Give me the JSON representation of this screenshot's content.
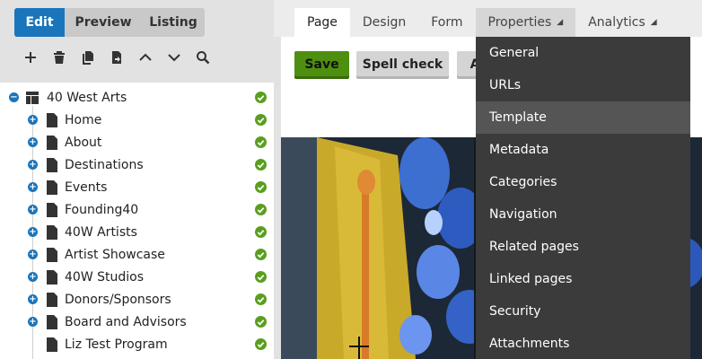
{
  "mode_tabs": {
    "edit": "Edit",
    "preview": "Preview",
    "listing": "Listing"
  },
  "toolbar_icons": [
    "plus-icon",
    "trash-icon",
    "copy-icon",
    "move-icon",
    "chevron-up-icon",
    "chevron-down-icon",
    "search-icon"
  ],
  "tree": {
    "root": {
      "label": "40 West Arts",
      "expanded": true,
      "published": true
    },
    "children": [
      {
        "label": "Home",
        "has_children": true,
        "published": true
      },
      {
        "label": "About",
        "has_children": true,
        "published": true
      },
      {
        "label": "Destinations",
        "has_children": true,
        "published": true
      },
      {
        "label": "Events",
        "has_children": true,
        "published": true
      },
      {
        "label": "Founding40",
        "has_children": true,
        "published": true
      },
      {
        "label": "40W Artists",
        "has_children": true,
        "published": true
      },
      {
        "label": "Artist Showcase",
        "has_children": true,
        "published": true
      },
      {
        "label": "40W Studios",
        "has_children": true,
        "published": true
      },
      {
        "label": "Donors/Sponsors",
        "has_children": true,
        "published": true
      },
      {
        "label": "Board and Advisors",
        "has_children": true,
        "published": true
      },
      {
        "label": "Liz Test Program",
        "has_children": false,
        "published": true
      }
    ]
  },
  "main_tabs": [
    {
      "label": "Page",
      "active": true
    },
    {
      "label": "Design"
    },
    {
      "label": "Form"
    },
    {
      "label": "Properties",
      "caret": true,
      "open": true
    },
    {
      "label": "Analytics",
      "caret": true
    }
  ],
  "actions": {
    "save": "Save",
    "spell_check": "Spell check",
    "third": "A"
  },
  "properties_menu": [
    {
      "label": "General"
    },
    {
      "label": "URLs"
    },
    {
      "label": "Template",
      "hover": true
    },
    {
      "label": "Metadata"
    },
    {
      "label": "Categories"
    },
    {
      "label": "Navigation"
    },
    {
      "label": "Related pages"
    },
    {
      "label": "Linked pages"
    },
    {
      "label": "Security"
    },
    {
      "label": "Attachments"
    }
  ],
  "colors": {
    "accent": "#1b75bb",
    "save": "#4e8f0f",
    "published": "#5a9e1e",
    "menu_bg": "#3b3b3b",
    "menu_hover": "#555555"
  }
}
